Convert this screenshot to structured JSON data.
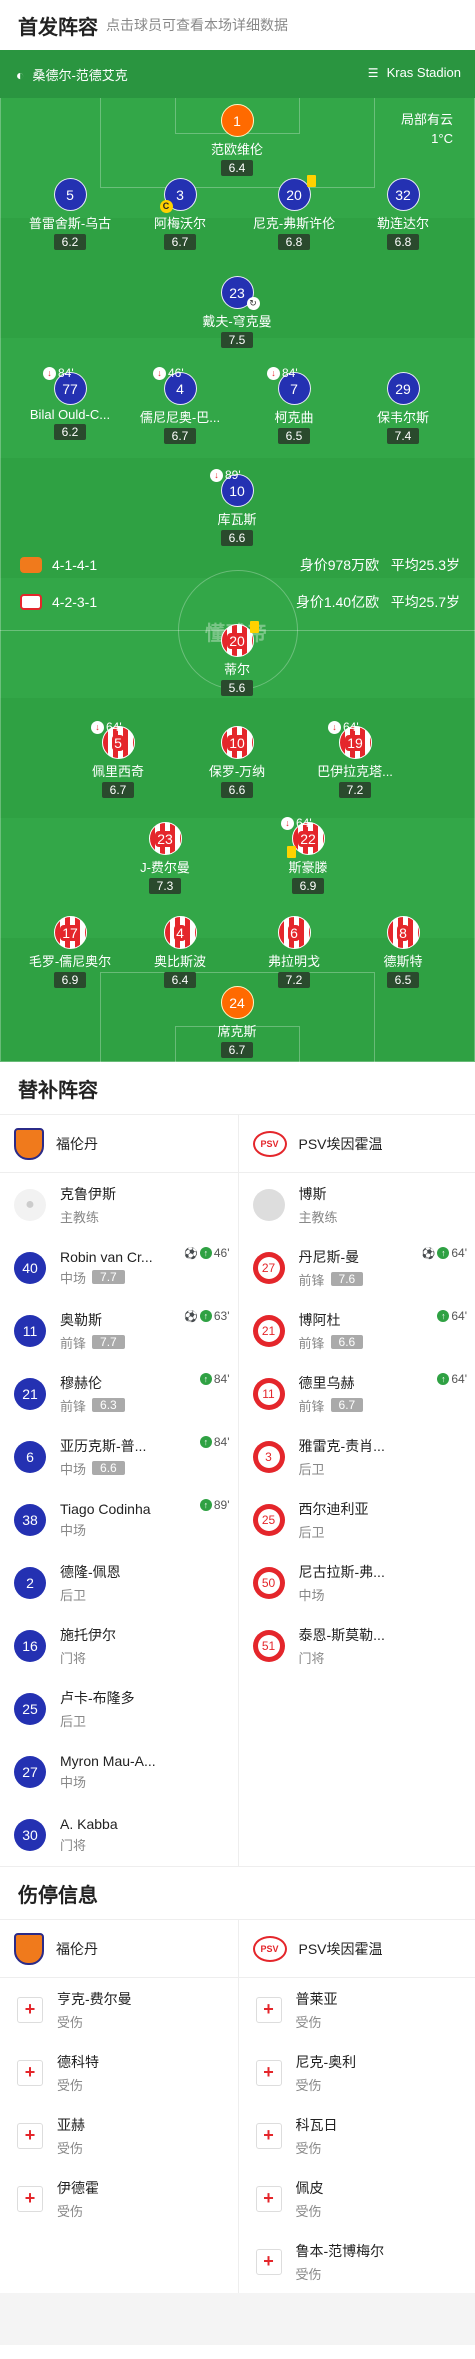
{
  "lineup": {
    "title": "首发阵容",
    "subtitle": "点击球员可查看本场详细数据"
  },
  "venue": {
    "stadium": "桑德尔-范德艾克",
    "right": "Kras Stadion"
  },
  "weather": {
    "line1": "局部有云",
    "line2": "1°C"
  },
  "home_team": {
    "formation": "4-1-4-1",
    "value": "身价978万欧",
    "age": "平均25.3岁"
  },
  "away_team": {
    "formation": "4-2-3-1",
    "value": "身价1.40亿欧",
    "age": "平均25.7岁"
  },
  "watermark": "懂球帝",
  "home_players": [
    {
      "num": "1",
      "name": "范欧维伦",
      "rating": "6.4"
    },
    {
      "num": "5",
      "name": "普雷舍斯-乌古",
      "rating": "6.2"
    },
    {
      "num": "3",
      "name": "阿梅沃尔",
      "rating": "6.7",
      "badge": "C"
    },
    {
      "num": "20",
      "name": "尼克-弗斯许伦",
      "rating": "6.8"
    },
    {
      "num": "32",
      "name": "勒连达尔",
      "rating": "6.8"
    },
    {
      "num": "23",
      "name": "戴夫-穹克曼",
      "rating": "7.5"
    },
    {
      "num": "77",
      "name": "Bilal Ould-C...",
      "rating": "6.2",
      "sub": "84'"
    },
    {
      "num": "4",
      "name": "儒尼尼奥-巴...",
      "rating": "6.7",
      "sub": "46'"
    },
    {
      "num": "7",
      "name": "柯克曲",
      "rating": "6.5",
      "sub": "84'"
    },
    {
      "num": "29",
      "name": "保韦尔斯",
      "rating": "7.4"
    },
    {
      "num": "10",
      "name": "库瓦斯",
      "rating": "6.6",
      "sub": "89'"
    }
  ],
  "away_players": [
    {
      "num": "20",
      "name": "蒂尔",
      "rating": "5.6"
    },
    {
      "num": "5",
      "name": "佩里西奇",
      "rating": "6.7",
      "sub": "64'"
    },
    {
      "num": "10",
      "name": "保罗-万纳",
      "rating": "6.6"
    },
    {
      "num": "19",
      "name": "巴伊拉克塔...",
      "rating": "7.2",
      "sub": "64'"
    },
    {
      "num": "23",
      "name": "J-费尔曼",
      "rating": "7.3"
    },
    {
      "num": "22",
      "name": "斯豪滕",
      "rating": "6.9",
      "sub": "64'"
    },
    {
      "num": "17",
      "name": "毛罗-儒尼奥尔",
      "rating": "6.9"
    },
    {
      "num": "4",
      "name": "奥比斯波",
      "rating": "6.4"
    },
    {
      "num": "6",
      "name": "弗拉明戈",
      "rating": "7.2"
    },
    {
      "num": "8",
      "name": "德斯特",
      "rating": "6.5"
    },
    {
      "num": "24",
      "name": "席克斯",
      "rating": "6.7"
    }
  ],
  "subs": {
    "title": "替补阵容",
    "home_name": "福伦丹",
    "away_name": "PSV埃因霍温",
    "psv_logo_text": "PSV",
    "home_coach": {
      "name": "克鲁伊斯",
      "role": "主教练"
    },
    "away_coach": {
      "name": "博斯",
      "role": "主教练"
    },
    "home": [
      {
        "num": "40",
        "name": "Robin van Cr...",
        "pos": "中场",
        "rating": "7.7",
        "ev": "46'",
        "goal": true
      },
      {
        "num": "11",
        "name": "奥勒斯",
        "pos": "前锋",
        "rating": "7.7",
        "ev": "63'",
        "goal": true
      },
      {
        "num": "21",
        "name": "穆赫伦",
        "pos": "前锋",
        "rating": "6.3",
        "ev": "84'"
      },
      {
        "num": "6",
        "name": "亚历克斯-普...",
        "pos": "中场",
        "rating": "6.6",
        "ev": "84'"
      },
      {
        "num": "38",
        "name": "Tiago Codinha",
        "pos": "中场",
        "ev": "89'"
      },
      {
        "num": "2",
        "name": "德隆-佩恩",
        "pos": "后卫"
      },
      {
        "num": "16",
        "name": "施托伊尔",
        "pos": "门将"
      },
      {
        "num": "25",
        "name": "卢卡-布隆多",
        "pos": "后卫"
      },
      {
        "num": "27",
        "name": "Myron Mau-A...",
        "pos": "中场"
      },
      {
        "num": "30",
        "name": "A. Kabba",
        "pos": "门将"
      }
    ],
    "away": [
      {
        "num": "27",
        "name": "丹尼斯-曼",
        "pos": "前锋",
        "rating": "7.6",
        "ev": "64'",
        "goal": true
      },
      {
        "num": "21",
        "name": "博阿杜",
        "pos": "前锋",
        "rating": "6.6",
        "ev": "64'"
      },
      {
        "num": "11",
        "name": "德里乌赫",
        "pos": "前锋",
        "rating": "6.7",
        "ev": "64'"
      },
      {
        "num": "3",
        "name": "雅雷克-责肖...",
        "pos": "后卫"
      },
      {
        "num": "25",
        "name": "西尔迪利亚",
        "pos": "后卫"
      },
      {
        "num": "50",
        "name": "尼古拉斯-弗...",
        "pos": "中场"
      },
      {
        "num": "51",
        "name": "泰恩-斯莫勒...",
        "pos": "门将"
      }
    ]
  },
  "injuries": {
    "title": "伤停信息",
    "home": [
      {
        "name": "亨克-费尔曼",
        "status": "受伤"
      },
      {
        "name": "德科特",
        "status": "受伤"
      },
      {
        "name": "亚赫",
        "status": "受伤"
      },
      {
        "name": "伊德霍",
        "status": "受伤"
      }
    ],
    "away": [
      {
        "name": "普莱亚",
        "status": "受伤"
      },
      {
        "name": "尼克-奥利",
        "status": "受伤"
      },
      {
        "name": "科瓦日",
        "status": "受伤"
      },
      {
        "name": "佩皮",
        "status": "受伤"
      },
      {
        "name": "鲁本-范博梅尔",
        "status": "受伤"
      }
    ]
  }
}
